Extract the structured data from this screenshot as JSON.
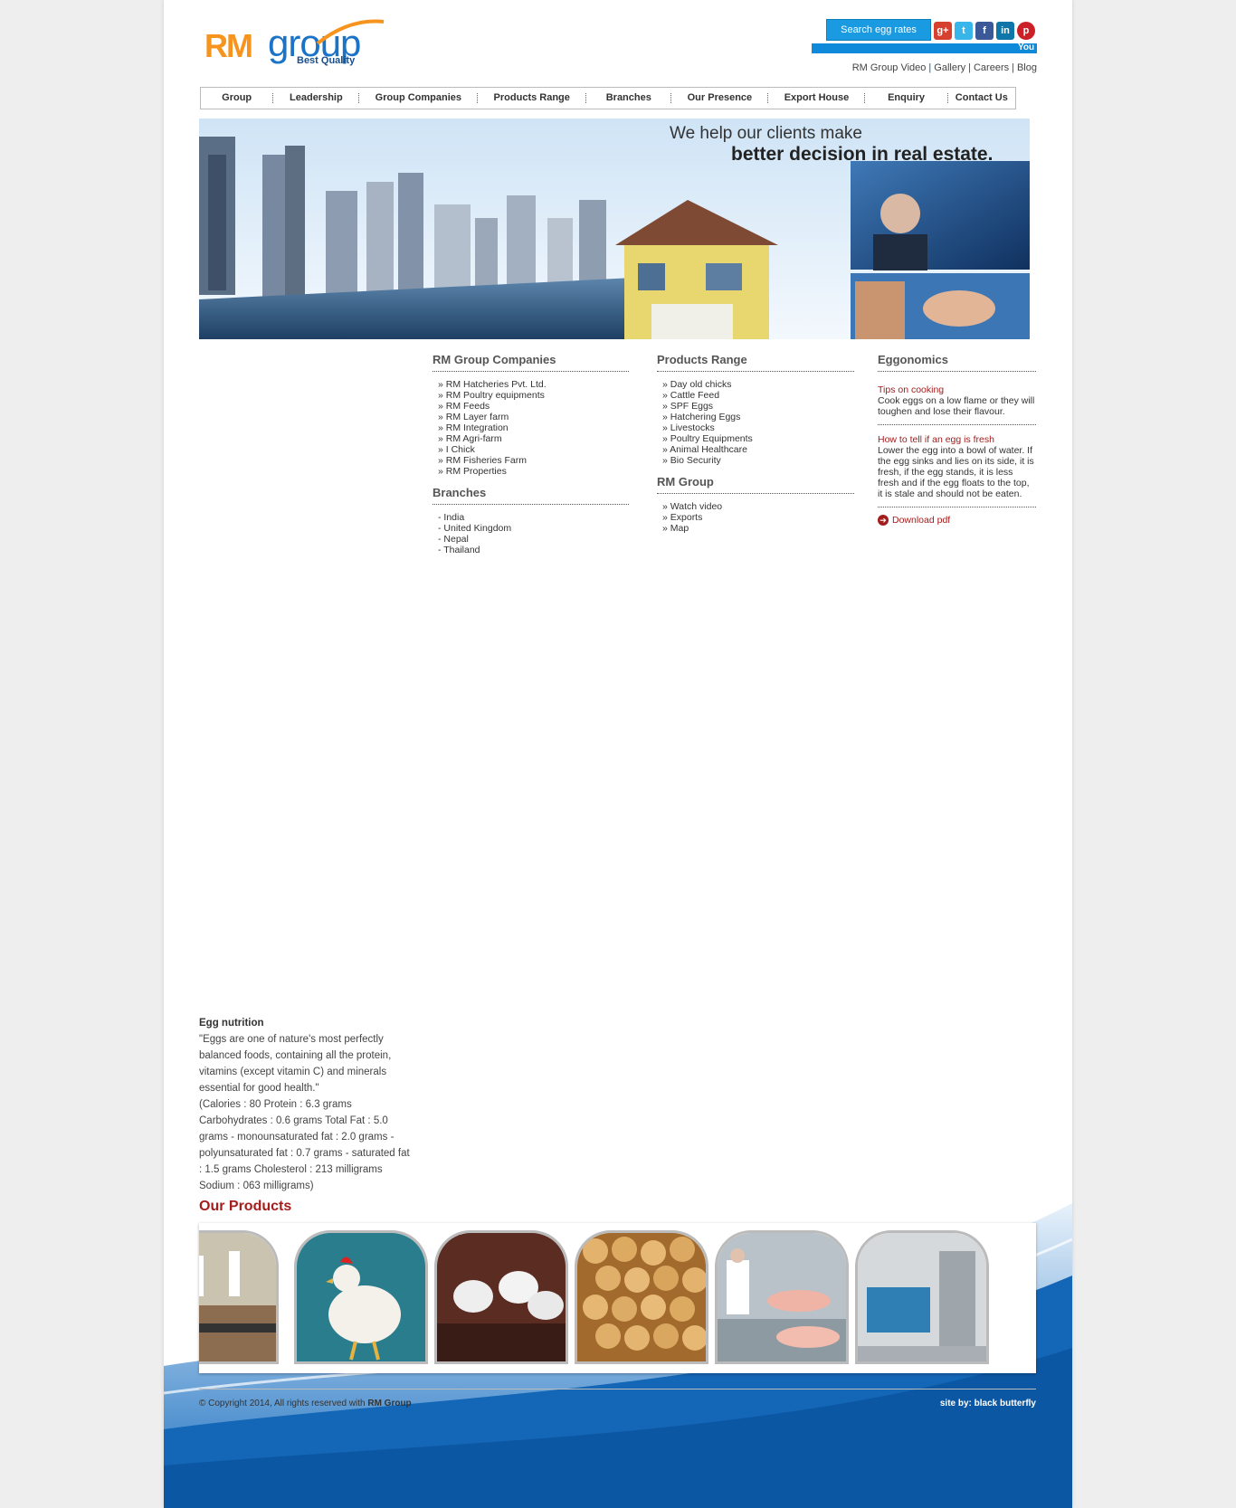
{
  "header": {
    "logo": {
      "rm": "RM",
      "group": "group",
      "tagline": "Best Quality"
    },
    "search_button": "Search egg rates",
    "social": [
      {
        "name": "google-plus-icon",
        "glyph": "g+",
        "color": "#d6402f"
      },
      {
        "name": "twitter-icon",
        "glyph": "t",
        "color": "#38b6ea"
      },
      {
        "name": "facebook-icon",
        "glyph": "f",
        "color": "#3b5998"
      },
      {
        "name": "linkedin-icon",
        "glyph": "in",
        "color": "#0e76a8"
      },
      {
        "name": "pinterest-icon",
        "glyph": "p",
        "color": "#cb2027"
      }
    ],
    "ticker": "You",
    "top_links": [
      "RM Group Video",
      "Gallery",
      "Careers",
      "Blog"
    ]
  },
  "nav": {
    "items": [
      "Group",
      "Leadership",
      "Group Companies",
      "Products Range",
      "Branches",
      "Our Presence",
      "Export House",
      "Enquiry",
      "Contact Us"
    ]
  },
  "banner": {
    "line1": "We help our clients make",
    "line2": "better decision in real estate."
  },
  "companies": {
    "title": "RM Group Companies",
    "items": [
      "» RM Hatcheries Pvt. Ltd.",
      "» RM Poultry equipments",
      "» RM Feeds",
      "» RM Layer farm",
      "» RM Integration",
      "» RM Agri-farm",
      "» I Chick",
      "» RM Fisheries Farm",
      "» RM Properties"
    ]
  },
  "branches": {
    "title": "Branches",
    "items": [
      "- India",
      "- United Kingdom",
      "- Nepal",
      "- Thailand"
    ]
  },
  "products_range": {
    "title": "Products Range",
    "items": [
      "» Day old chicks",
      "» Cattle Feed",
      "» SPF Eggs",
      "» Hatchering Eggs",
      "» Livestocks",
      "» Poultry Equipments",
      "» Animal Healthcare",
      "» Bio Security"
    ]
  },
  "rm_group": {
    "title": "RM Group",
    "items": [
      "» Watch video",
      "» Exports",
      "» Map"
    ]
  },
  "eggonomics": {
    "title": "Eggonomics",
    "tip1_title": "Tips on cooking",
    "tip1_text": "Cook eggs on a low flame or they will toughen and lose their flavour.",
    "tip2_title": "How to tell if an egg is fresh",
    "tip2_text": "Lower the egg into a bowl of water. If the egg sinks and lies on its side, it is fresh, if the egg stands, it is less fresh and if the egg floats to the top, it is stale and should not be eaten.",
    "download": "Download pdf"
  },
  "egg_nutrition": {
    "title": "Egg nutrition",
    "quote": "\"Eggs are one of nature's most perfectly balanced foods, containing all the protein, vitamins (except vitamin C) and minerals essential for good health.\"",
    "facts": "(Calories : 80 Protein : 6.3 grams Carbohydrates : 0.6 grams Total Fat : 5.0 grams - monounsaturated fat : 2.0 grams - polyunsaturated fat : 0.7 grams - saturated fat : 1.5 grams Cholesterol : 213 milligrams Sodium : 063 milligrams)"
  },
  "products": {
    "title": "Our Products"
  },
  "footer": {
    "copyright_prefix": "© Copyright 2014, All rights reserved with ",
    "copyright_brand": "RM Group",
    "credit": "site by: black butterfly"
  }
}
